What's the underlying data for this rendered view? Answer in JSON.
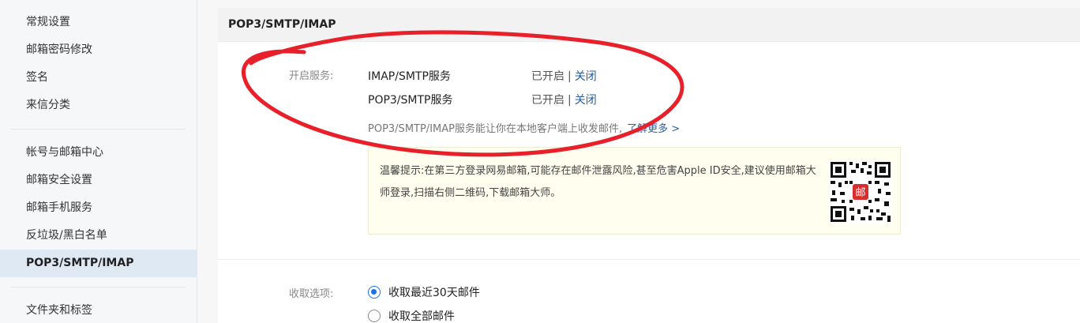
{
  "sidebar": {
    "group1": [
      "常规设置",
      "邮箱密码修改",
      "签名",
      "来信分类"
    ],
    "group2": [
      "帐号与邮箱中心",
      "邮箱安全设置",
      "邮箱手机服务",
      "反垃圾/黑白名单",
      "POP3/SMTP/IMAP"
    ],
    "group3": [
      "文件夹和标签"
    ]
  },
  "section": {
    "title": "POP3/SMTP/IMAP"
  },
  "services": {
    "label": "开启服务:",
    "items": [
      {
        "name": "IMAP/SMTP服务",
        "status": "已开启",
        "sep": "|",
        "action": "关闭"
      },
      {
        "name": "POP3/SMTP服务",
        "status": "已开启",
        "sep": "|",
        "action": "关闭"
      }
    ],
    "description": "POP3/SMTP/IMAP服务能让你在本地客户端上收发邮件,",
    "learn_more": "了解更多 >"
  },
  "tip": {
    "text": "温馨提示:在第三方登录网易邮箱,可能存在邮件泄露风险,甚至危害Apple ID安全,建议使用邮箱大师登录,扫描右侧二维码,下载邮箱大师。",
    "qr_icon": "qr-code-icon",
    "qr_badge": "邮"
  },
  "receive": {
    "label": "收取选项:",
    "options": [
      {
        "label": "收取最近30天邮件",
        "checked": true
      },
      {
        "label": "收取全部邮件",
        "checked": false
      }
    ]
  },
  "colors": {
    "accent": "#2a5d9f",
    "annotation": "#e8202a",
    "radio_checked": "#1a73e8",
    "tip_bg": "#fffeef"
  }
}
